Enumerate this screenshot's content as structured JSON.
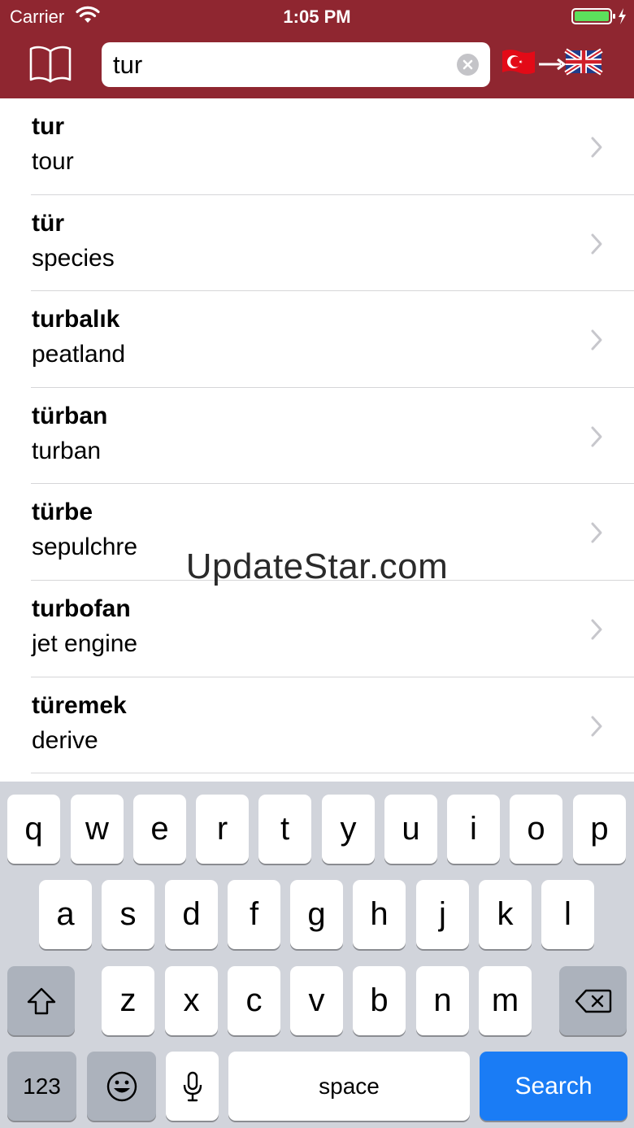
{
  "status_bar": {
    "carrier": "Carrier",
    "time": "1:05 PM"
  },
  "header": {
    "search_value": "tur",
    "source_language_flag": "turkey-flag-icon",
    "target_language_flag": "uk-flag-icon"
  },
  "results": [
    {
      "term": "tur",
      "meaning": "tour"
    },
    {
      "term": "tür",
      "meaning": "species"
    },
    {
      "term": "turbalık",
      "meaning": "peatland"
    },
    {
      "term": "türban",
      "meaning": "turban"
    },
    {
      "term": "türbe",
      "meaning": "sepulchre"
    },
    {
      "term": "turbofan",
      "meaning": "jet engine"
    },
    {
      "term": "türemek",
      "meaning": "derive"
    }
  ],
  "watermark": "UpdateStar.com",
  "keyboard": {
    "row1": [
      "q",
      "w",
      "e",
      "r",
      "t",
      "y",
      "u",
      "i",
      "o",
      "p"
    ],
    "row2": [
      "a",
      "s",
      "d",
      "f",
      "g",
      "h",
      "j",
      "k",
      "l"
    ],
    "row3": [
      "z",
      "x",
      "c",
      "v",
      "b",
      "n",
      "m"
    ],
    "numbers_label": "123",
    "space_label": "space",
    "search_label": "Search"
  },
  "colors": {
    "header": "#8f2630",
    "keyboard_bg": "#d1d4db",
    "search_key": "#1a7cf5"
  }
}
